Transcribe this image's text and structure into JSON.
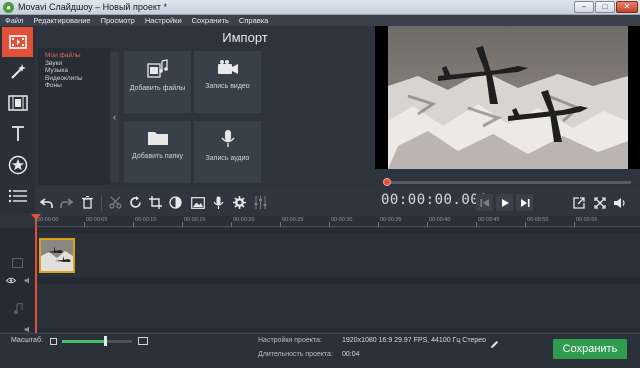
{
  "window": {
    "title": "Movavi Слайдшоу – Новый проект *",
    "icon": "movavi-app-icon",
    "controls": [
      "minimize",
      "maximize",
      "close"
    ]
  },
  "menu": [
    "Файл",
    "Редактирование",
    "Просмотр",
    "Настройки",
    "Сохранить",
    "Справка"
  ],
  "sidebar": {
    "items": [
      {
        "icon": "film-import-icon",
        "active": true
      },
      {
        "icon": "magic-wand-icon",
        "active": false
      },
      {
        "icon": "filmstrip-icon",
        "active": false
      },
      {
        "icon": "text-icon",
        "active": false
      },
      {
        "icon": "star-badge-icon",
        "active": false
      },
      {
        "icon": "list-menu-icon",
        "active": false
      }
    ]
  },
  "import": {
    "title": "Импорт",
    "categories": [
      "Мои файлы",
      "Звуки",
      "Музыка",
      "Видеоклипы",
      "Фоны"
    ],
    "active_category": "Мои файлы",
    "tiles": [
      {
        "label": "Добавить файлы",
        "icon": "add-files-icon"
      },
      {
        "label": "Запись видео",
        "icon": "video-camera-icon"
      },
      {
        "label": "Добавить папку",
        "icon": "folder-icon"
      },
      {
        "label": "Запись аудио",
        "icon": "microphone-icon"
      }
    ]
  },
  "player": {
    "timecode": "00:00:00.000",
    "progress": 0
  },
  "toolbar": {
    "tools": [
      "undo-icon",
      "redo-icon",
      "delete-icon",
      "cut-icon",
      "rotate-icon",
      "crop-icon",
      "color-adjust-icon",
      "image-icon",
      "mic-icon",
      "settings-icon",
      "equalizer-icon"
    ]
  },
  "timeline": {
    "ticks": [
      "00:00:00",
      "00:00:05",
      "00:00:10",
      "00:00:15",
      "00:00:20",
      "00:00:25",
      "00:00:30",
      "00:00:35",
      "00:00:40",
      "00:00:45",
      "00:00:50",
      "00:00:55"
    ]
  },
  "bottom": {
    "zoom_label": "Масштаб:",
    "zoom_level": 0.62,
    "settings_label": "Настройки проекта:",
    "settings_value": "1920x1080 16:9 29.97 FPS, 44100 Гц Стерео",
    "duration_label": "Длительность проекта:",
    "duration_value": "00:04",
    "save_label": "Сохранить"
  },
  "colors": {
    "accent": "#e2503a",
    "save": "#2f9c4e",
    "clip_border": "#d9a21a"
  }
}
